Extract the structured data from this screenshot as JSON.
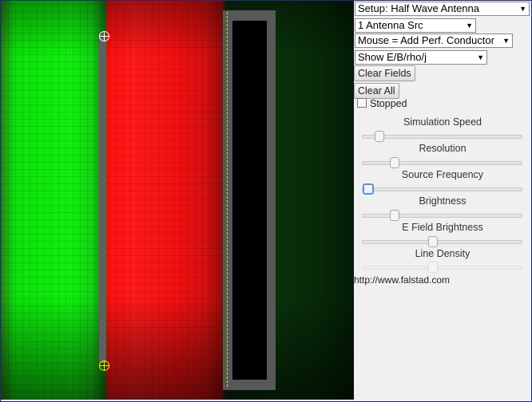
{
  "canvas": {
    "simulation_view": "EM field simulation"
  },
  "panel": {
    "setup_select": "Setup: Half Wave Antenna",
    "source_select": "1 Antenna Src",
    "mouse_select": "Mouse = Add Perf. Conductor",
    "show_select": "Show E/B/rho/j",
    "clear_fields_button": "Clear Fields",
    "clear_all_button": "Clear All",
    "stopped_label": "Stopped",
    "stopped_checked": false,
    "sliders": [
      {
        "label": "Simulation Speed",
        "value": 0.08
      },
      {
        "label": "Resolution",
        "value": 0.18
      },
      {
        "label": "Source Frequency",
        "value": 0.0
      },
      {
        "label": "Brightness",
        "value": 0.18
      },
      {
        "label": "E Field Brightness",
        "value": 0.44
      },
      {
        "label": "Line Density",
        "value": 0.44
      }
    ],
    "url": "http://www.falstad.com"
  }
}
